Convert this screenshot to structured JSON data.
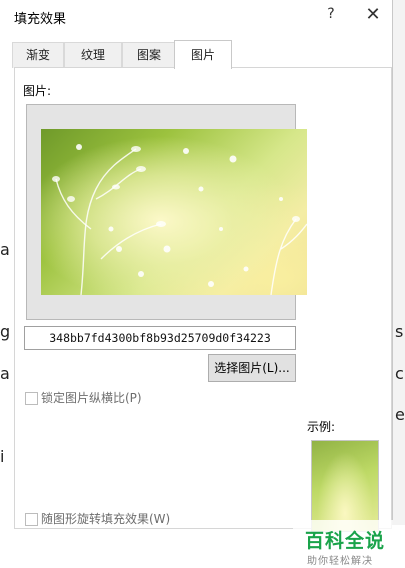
{
  "dialog": {
    "title": "填充效果",
    "help_label": "?",
    "close_label": "✕"
  },
  "tabs": [
    {
      "label": "渐变",
      "active": false
    },
    {
      "label": "纹理",
      "active": false
    },
    {
      "label": "图案",
      "active": false
    },
    {
      "label": "图片",
      "active": true
    }
  ],
  "picture_tab": {
    "picture_label": "图片:",
    "picture_name": "348bb7fd4300bf8b93d25709d0f34223",
    "select_button_label": "选择图片(L)...",
    "lock_aspect_label": "锁定图片纵横比(P)",
    "rotate_with_shape_label": "随图形旋转填充效果(W)",
    "sample_label": "示例:"
  },
  "watermark": {
    "title": "百科全说",
    "subtitle": "助你轻松解决"
  },
  "background_doc": {
    "chars": [
      "a",
      "g",
      "a",
      "i",
      "s",
      "e",
      "c"
    ]
  },
  "colors": {
    "accent_green": "#1aa34a"
  }
}
